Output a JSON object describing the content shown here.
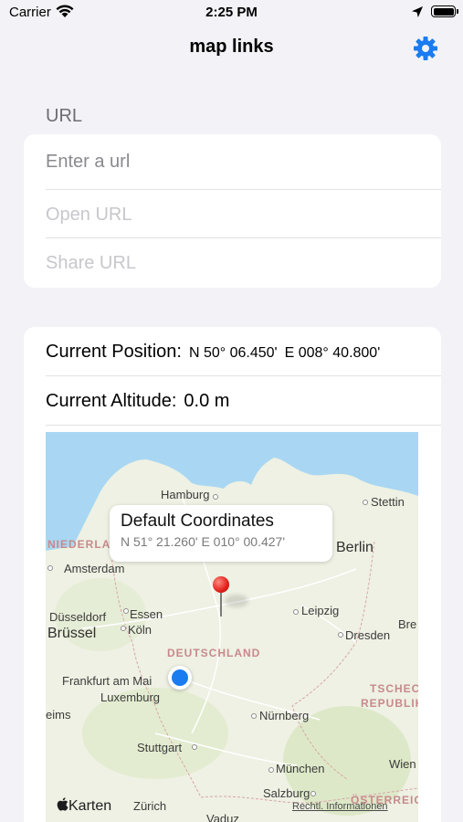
{
  "status_bar": {
    "carrier": "Carrier",
    "time": "2:25 PM"
  },
  "nav": {
    "title": "map links",
    "settings_icon": "gear-icon"
  },
  "url_section": {
    "header": "URL",
    "input_placeholder": "Enter a url",
    "open_label": "Open URL",
    "share_label": "Share URL"
  },
  "position": {
    "current_position_label": "Current Position:",
    "latitude": "N  50° 06.450'",
    "longitude": "E 008° 40.800'",
    "current_altitude_label": "Current Altitude:",
    "altitude_value": "0.0 m"
  },
  "map": {
    "callout_title": "Default Coordinates",
    "callout_coordinates": "N  51° 21.260'  E 010° 00.427'",
    "attribution_logo": "Karten",
    "legal_link": "Rechtl. Informationen",
    "cities": {
      "hamburg": "Hamburg",
      "stettin": "Stettin",
      "berlin": "Berlin",
      "amsterdam": "Amsterdam",
      "niederlande": "NIEDERLA",
      "leipzig": "Leipzig",
      "dusseldorf": "Düsseldorf",
      "essen": "Essen",
      "brussel": "Brüssel",
      "koln": "Köln",
      "dresden": "Dresden",
      "bre": "Bre",
      "deutschland": "DEUTSCHLAND",
      "frankfurt": "Frankfurt am Mai",
      "luxemburg": "Luxemburg",
      "tschechische": "TSCHECHISC",
      "republik": "REPUBLIK",
      "eims": "eims",
      "nurnberg": "Nürnberg",
      "stuttgart": "Stuttgart",
      "munchen": "München",
      "wien": "Wien",
      "salzburg": "Salzburg",
      "zurich": "Zürich",
      "vaduz": "Vaduz",
      "osterreich": "ÖSTERREICH"
    }
  },
  "colors": {
    "accent": "#1a7cf0",
    "pin": "#e0201a",
    "water": "#a9d7f3",
    "land": "#eef1e3"
  }
}
